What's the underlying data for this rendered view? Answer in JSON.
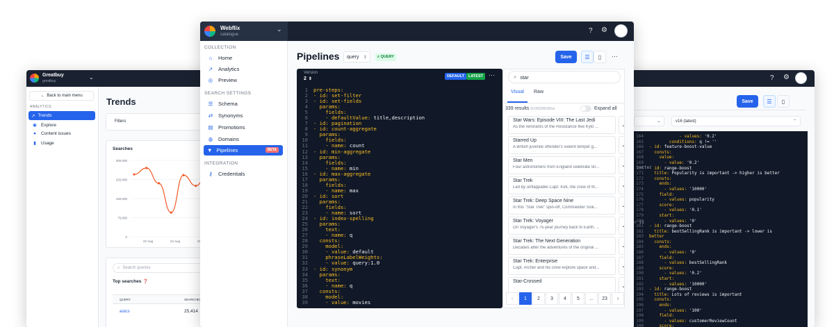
{
  "greatbuy": {
    "brand": "Greatbuy",
    "sub": "greatbuy",
    "back": "Back to main menu",
    "section": "ANALYTICS",
    "nav": [
      {
        "label": "Trends",
        "icon": "trend-icon"
      },
      {
        "label": "Explore",
        "icon": "compass-icon"
      },
      {
        "label": "Content issues",
        "icon": "alert-icon"
      },
      {
        "label": "Usage",
        "icon": "bar-chart-icon"
      }
    ],
    "title": "Trends",
    "filters": "Filters",
    "searches_title": "Searches",
    "yticks": [
      "300,000",
      "225,000",
      "150,000",
      "75,000",
      "0"
    ],
    "xticks": [
      "22 Aug",
      "24 Aug",
      "26 A"
    ],
    "search_placeholder": "Search queries",
    "top_searches": "Top searches",
    "col_query": "QUERY",
    "col_searches": "SEARCHES",
    "row_query": "asics",
    "row_count": "25,414"
  },
  "chart_data": {
    "type": "line",
    "series": [
      {
        "values": [
          245000,
          270000,
          210000,
          95000,
          242000,
          200000,
          255000,
          235000,
          230000
        ]
      }
    ],
    "ylim": [
      0,
      300000
    ]
  },
  "webflix": {
    "brand": "Webflix",
    "sub": "catalogue",
    "sec_collection": "COLLECTION",
    "nav1": [
      "Home",
      "Analytics",
      "Preview"
    ],
    "sec_search": "SEARCH SETTINGS",
    "nav2": [
      "Schema",
      "Synonyms",
      "Promotions",
      "Domains",
      "Pipelines"
    ],
    "beta": "BETA",
    "sec_integration": "INTEGRATION",
    "nav3": [
      "Credentials"
    ],
    "page_title": "Pipelines",
    "select_value": "query",
    "query_badge": "QUERY",
    "save": "Save",
    "version_label": "Version",
    "version_value": "2",
    "default_badge": "DEFAULT",
    "latest_badge": "LATEST",
    "search_value": "star",
    "tab_visual": "Visual",
    "tab_raw": "Raw",
    "results_count": "339 results",
    "results_time": "(0.002296155s)",
    "expand_all": "Expand all",
    "results": [
      {
        "title": "Star Wars: Episode VIII: The Last Jedi",
        "desc": "As the remnants of the Resistance flee Kylo ..."
      },
      {
        "title": "Starred Up",
        "desc": "A British juvenile offender's violent temper g..."
      },
      {
        "title": "Star Men",
        "desc": "Four astronomers from England celebrate 50..."
      },
      {
        "title": "Star Trek",
        "desc": "Led by unflappable Capt. Kirk, the crew of th..."
      },
      {
        "title": "Star Trek: Deep Space Nine",
        "desc": "In this \"Star Trek\" spin-off, Commander Sisk..."
      },
      {
        "title": "Star Trek: Voyager",
        "desc": "On Voyager's 75-year journey back to Earth, ..."
      },
      {
        "title": "Star Trek: The Next Generation",
        "desc": "Decades after the adventures of the original ..."
      },
      {
        "title": "Star Trek: Enterprise",
        "desc": "Capt. Archer and his crew explore space and..."
      },
      {
        "title": "Star-Crossed",
        "desc": ""
      }
    ],
    "pages": [
      "1",
      "2",
      "3",
      "4",
      "5",
      "...",
      "23"
    ],
    "code": [
      [
        "pre-steps:",
        ""
      ],
      [
        "- id: set-filter",
        ""
      ],
      [
        "- id: set-fields",
        ""
      ],
      [
        "  params:",
        ""
      ],
      [
        "    fields:",
        ""
      ],
      [
        "    - defaultValue:",
        " title,description"
      ],
      [
        "- id: pagination",
        ""
      ],
      [
        "- id: count-aggregate",
        ""
      ],
      [
        "  params:",
        ""
      ],
      [
        "    fields:",
        ""
      ],
      [
        "    - name:",
        " count"
      ],
      [
        "- id: min-aggregate",
        ""
      ],
      [
        "  params:",
        ""
      ],
      [
        "    fields:",
        ""
      ],
      [
        "    - name:",
        " min"
      ],
      [
        "- id: max-aggregate",
        ""
      ],
      [
        "  params:",
        ""
      ],
      [
        "    fields:",
        ""
      ],
      [
        "    - name:",
        " max"
      ],
      [
        "- id: sort",
        ""
      ],
      [
        "  params:",
        ""
      ],
      [
        "    fields:",
        ""
      ],
      [
        "    - name:",
        " sort"
      ],
      [
        "- id: index-spelling",
        ""
      ],
      [
        "  params:",
        ""
      ],
      [
        "    text:",
        ""
      ],
      [
        "    - name:",
        " q"
      ],
      [
        "  consts:",
        ""
      ],
      [
        "    model:",
        ""
      ],
      [
        "    - value:",
        " default"
      ],
      [
        "    phraseLabelWeights:",
        ""
      ],
      [
        "    - value:",
        " query:1.0"
      ],
      [
        "- id: synonym",
        ""
      ],
      [
        "  params:",
        ""
      ],
      [
        "    text:",
        ""
      ],
      [
        "    - name:",
        " q"
      ],
      [
        "  consts:",
        ""
      ],
      [
        "    model:",
        ""
      ],
      [
        "    - value:",
        " movies"
      ]
    ]
  },
  "right": {
    "save": "Save",
    "select_value": "v16 (latest)",
    "start_line": 164,
    "code": [
      [
        "            - values:",
        " '0.2'"
      ],
      [
        "        conditions:",
        " q != ''"
      ],
      [
        "- id:",
        " feature-boost-value"
      ],
      [
        "  consts:",
        ""
      ],
      [
        "    value:",
        ""
      ],
      [
        "      - value:",
        " '0.2'"
      ],
      [
        "- id:",
        " range-boost"
      ],
      [
        "  title:",
        " Popularity is important -> higher is better"
      ],
      [
        "  consts:",
        ""
      ],
      [
        "    ends:",
        ""
      ],
      [
        "      - values:",
        " '10000'"
      ],
      [
        "    field:",
        ""
      ],
      [
        "      - values:",
        " popularity"
      ],
      [
        "    score:",
        ""
      ],
      [
        "      - values:",
        " '0.1'"
      ],
      [
        "    start:",
        ""
      ],
      [
        "      - values:",
        " '0'"
      ],
      [
        "- id:",
        " range-boost"
      ],
      [
        "  title:",
        " bestSellingRank is important -> lower is"
      ],
      [
        "better",
        ""
      ],
      [
        "  consts:",
        ""
      ],
      [
        "    ends:",
        ""
      ],
      [
        "      - values:",
        " '0'"
      ],
      [
        "    field:",
        ""
      ],
      [
        "      - values:",
        " bestSellingRank"
      ],
      [
        "    score:",
        ""
      ],
      [
        "      - values:",
        " '0.2'"
      ],
      [
        "    start:",
        ""
      ],
      [
        "      - values:",
        " '10000'"
      ],
      [
        "- id:",
        " range-boost"
      ],
      [
        "  title:",
        " Lots of reviews is important"
      ],
      [
        "  consts:",
        ""
      ],
      [
        "    ends:",
        ""
      ],
      [
        "      - values:",
        " '100'"
      ],
      [
        "    field:",
        ""
      ],
      [
        "      - values:",
        " customerReviewCount"
      ],
      [
        "    score:",
        ""
      ]
    ],
    "mid_frag": [
      "r is better",
      "lower is"
    ]
  }
}
